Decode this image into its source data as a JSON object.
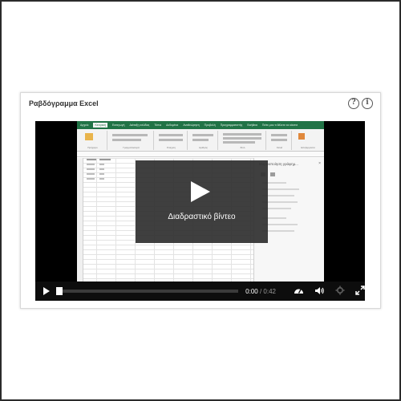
{
  "card": {
    "title": "Ραβδόγραμμα Excel",
    "help_icon_glyph": "?",
    "info_icon_glyph": "i"
  },
  "excel_preview": {
    "ribbon_tabs": [
      "Αρχείο",
      "Κεντρική",
      "Εισαγωγή",
      "Διάταξη σελίδας",
      "Τύποι",
      "Δεδομένα",
      "Αναθεώρηση",
      "Προβολή",
      "Προγραμματιστής",
      "Βοήθεια",
      "Πείτε μου τι θέλετε να κάνετε"
    ],
    "ribbon_groups": [
      "Πρόχειρο",
      "Γραμματοσειρά",
      "Στοίχιση",
      "Αριθμός",
      "Στυλ",
      "Κελιά",
      "Επεξεργασία"
    ],
    "task_pane_title": "Μορφοποίηση γράφημ..."
  },
  "overlay": {
    "label": "Διαδραστικό βίντεο"
  },
  "controls": {
    "current_time": "0:00",
    "separator": "/",
    "duration": "0:42",
    "progress": 0.0
  },
  "icons": {
    "play": "play-icon",
    "speed": "speedometer-icon",
    "volume": "volume-icon",
    "settings": "gear-icon",
    "fullscreen": "fullscreen-icon"
  }
}
